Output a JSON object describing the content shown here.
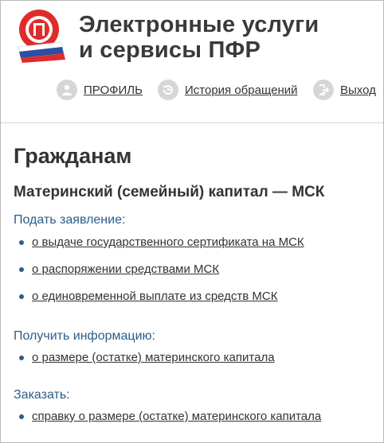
{
  "header": {
    "title_line1": "Электронные услуги",
    "title_line2": "и сервисы ПФР"
  },
  "nav": {
    "profile": "ПРОФИЛЬ",
    "history": "История обращений",
    "logout": "Выход"
  },
  "main": {
    "page_title": "Гражданам",
    "section_title": "Материнский (семейный) капитал — МСК",
    "groups": [
      {
        "title": "Подать заявление:",
        "links": [
          "о выдаче государственного сертификата на МСК",
          "о распоряжении средствами МСК",
          "о единовременной выплате из средств МСК"
        ]
      },
      {
        "title": "Получить информацию:",
        "links": [
          "о размере (остатке) материнского капитала"
        ]
      },
      {
        "title": "Заказать:",
        "links": [
          "справку о размере (остатке) материнского капитала"
        ]
      }
    ]
  },
  "colors": {
    "accent": "#2d5d8a",
    "logo_red": "#e02b2b",
    "icon_gray": "#d6d6d6"
  },
  "icons": [
    "pfr-logo-icon",
    "profile-icon",
    "history-icon",
    "logout-icon"
  ]
}
